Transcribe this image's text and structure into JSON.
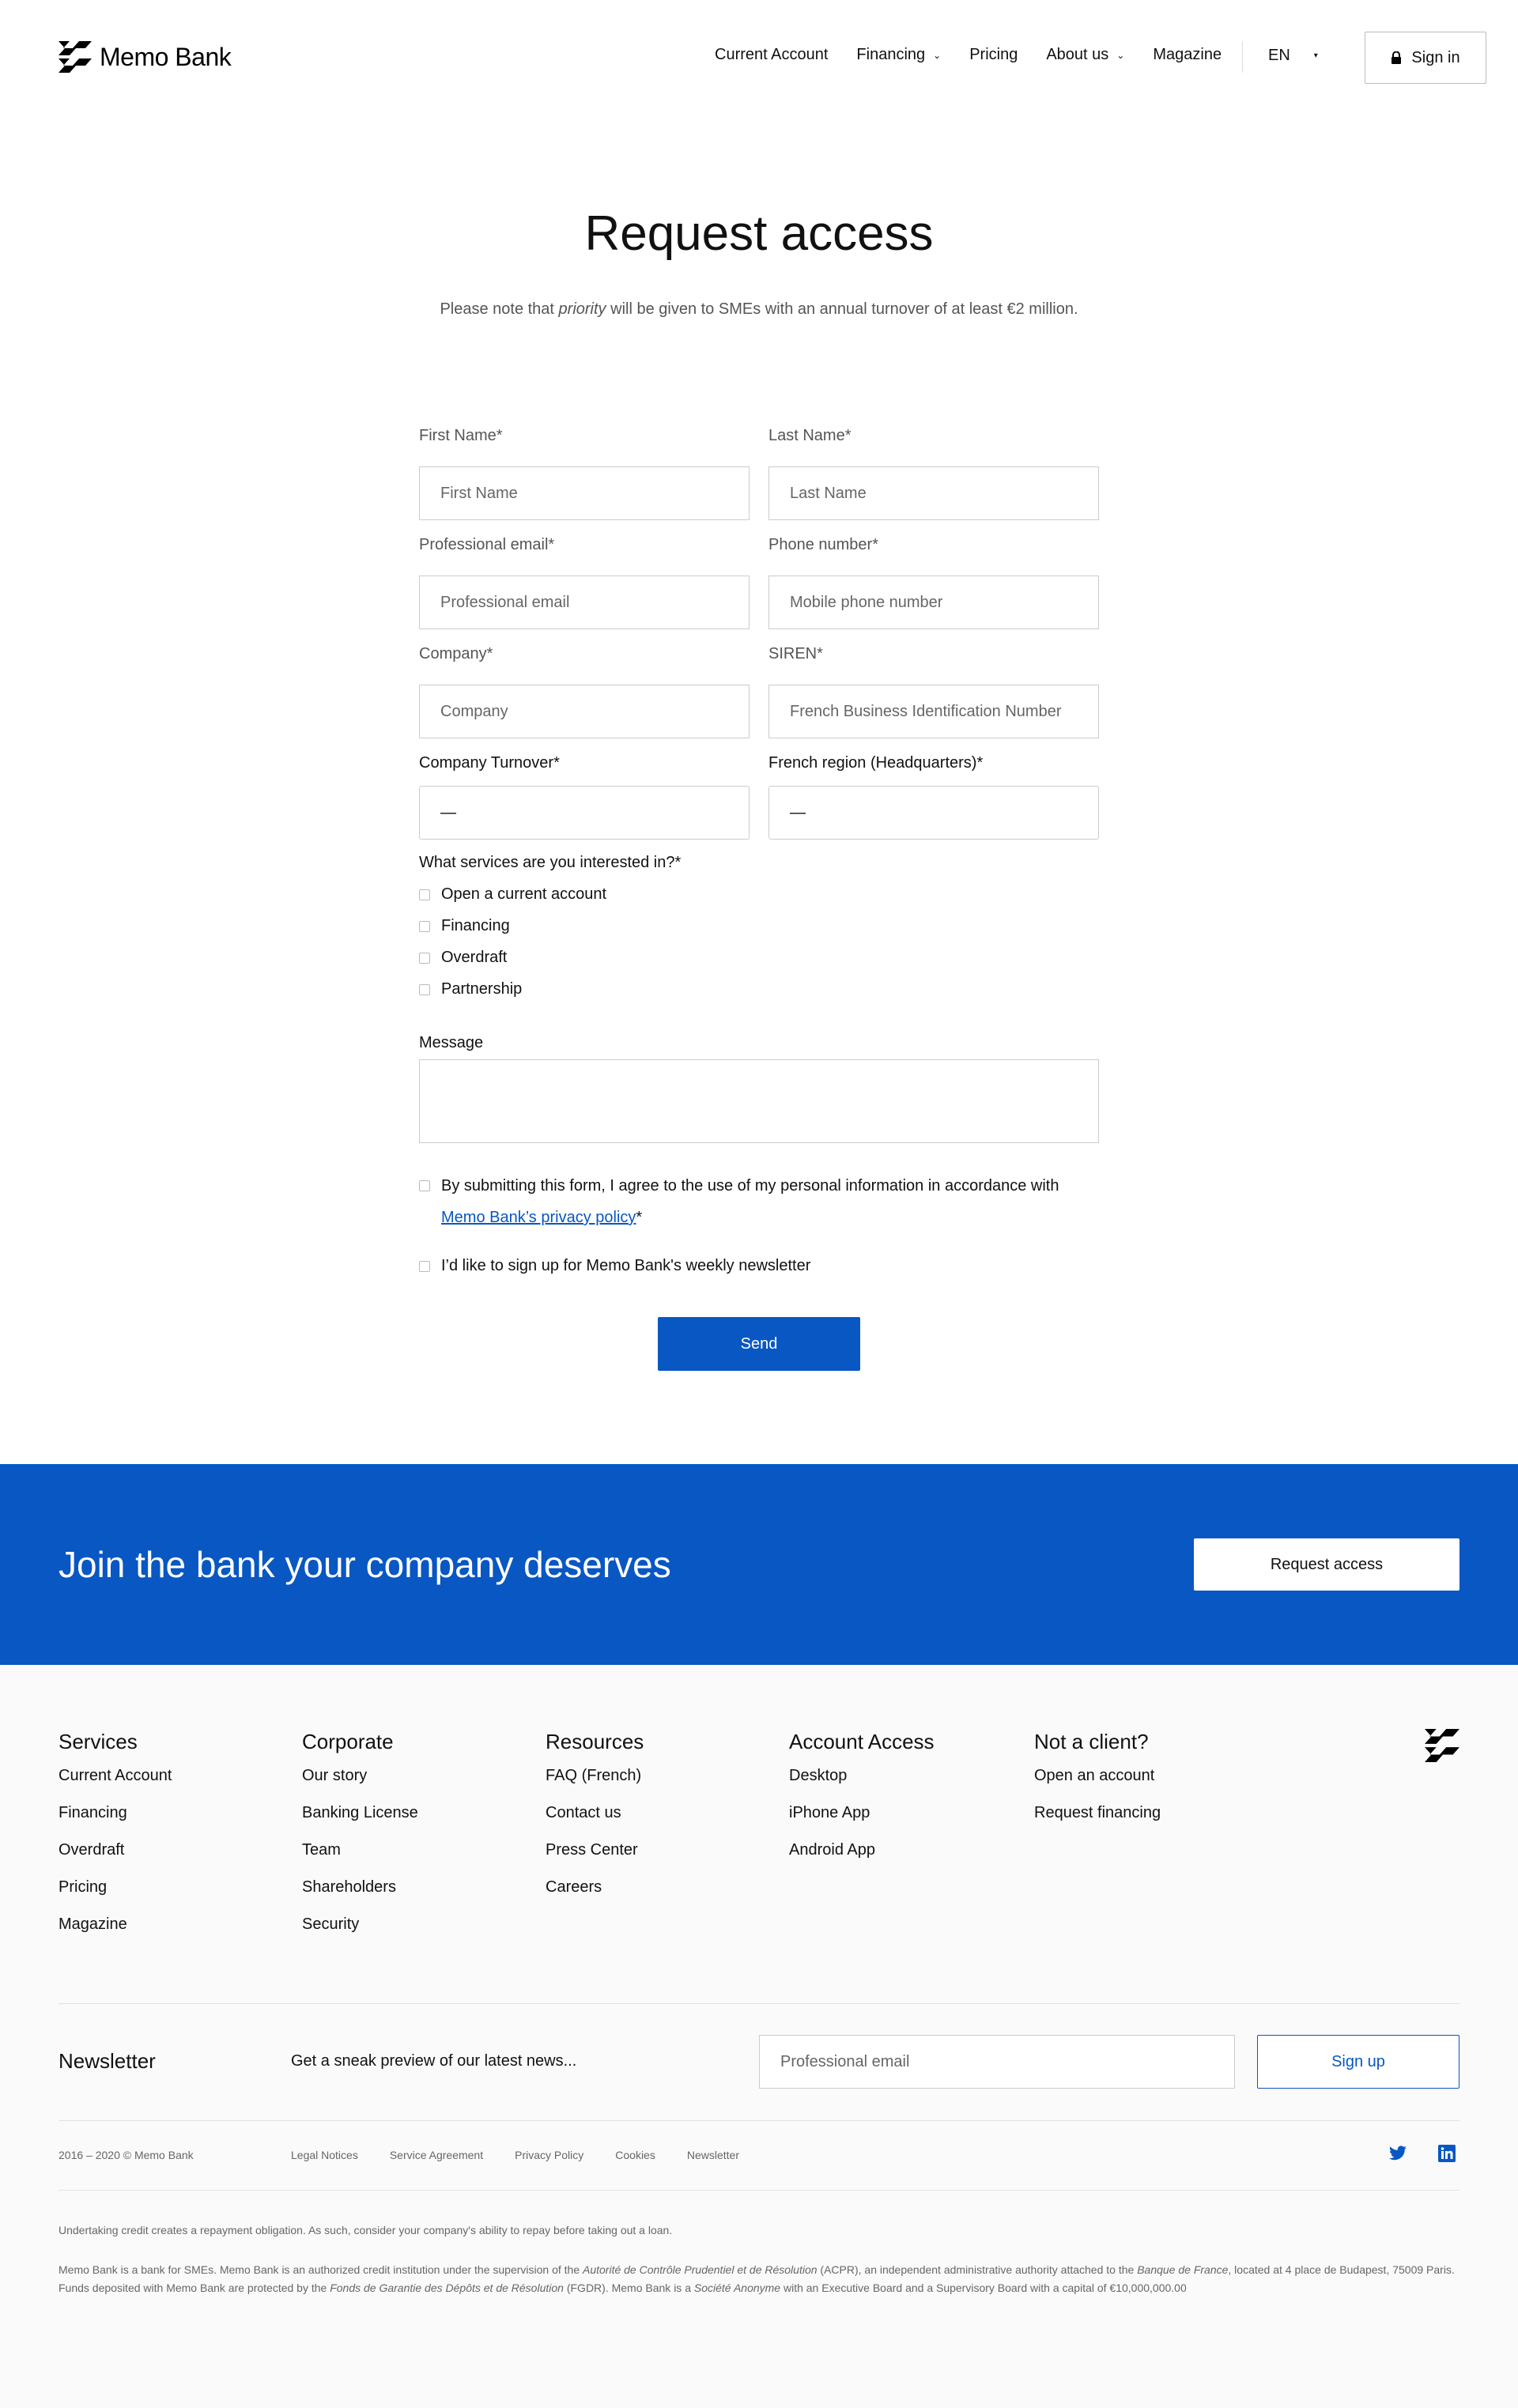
{
  "header": {
    "logo_text": "Memo Bank",
    "nav": [
      {
        "label": "Current Account",
        "dropdown": false
      },
      {
        "label": "Financing",
        "dropdown": true
      },
      {
        "label": "Pricing",
        "dropdown": false
      },
      {
        "label": "About us",
        "dropdown": true
      },
      {
        "label": "Magazine",
        "dropdown": false
      }
    ],
    "language": "EN",
    "signin_label": "Sign in"
  },
  "page": {
    "title": "Request access",
    "subtitle_before": "Please note that ",
    "subtitle_emphasis": "priority",
    "subtitle_after": " will be given to SMEs with an annual turnover of at least €2 million."
  },
  "form": {
    "first_name": {
      "label": "First Name*",
      "placeholder": "First Name"
    },
    "last_name": {
      "label": "Last Name*",
      "placeholder": "Last Name"
    },
    "email": {
      "label": "Professional email*",
      "placeholder": "Professional email"
    },
    "phone": {
      "label": "Phone number*",
      "placeholder": "Mobile phone number"
    },
    "company": {
      "label": "Company*",
      "placeholder": "Company"
    },
    "siren": {
      "label": "SIREN*",
      "placeholder": "French Business Identification Number"
    },
    "turnover": {
      "label": "Company Turnover*",
      "value": "—"
    },
    "region": {
      "label": "French region (Headquarters)*",
      "value": "—"
    },
    "services_label": "What services are you interested in?*",
    "services": [
      "Open a current account",
      "Financing",
      "Overdraft",
      "Partnership"
    ],
    "message_label": "Message",
    "consent_text": "By submitting this form, I agree to the use of my personal information in accordance with ",
    "consent_link": "Memo Bank’s privacy policy",
    "consent_suffix": "*",
    "newsletter_label": "I’d like to sign up for Memo Bank's weekly newsletter",
    "send_label": "Send"
  },
  "banner": {
    "title": "Join the bank your company deserves",
    "button": "Request access"
  },
  "footer": {
    "columns": [
      {
        "title": "Services",
        "items": [
          "Current Account",
          "Financing",
          "Overdraft",
          "Pricing",
          "Magazine"
        ]
      },
      {
        "title": "Corporate",
        "items": [
          "Our story",
          "Banking License",
          "Team",
          "Shareholders",
          "Security"
        ]
      },
      {
        "title": "Resources",
        "items": [
          "FAQ (French)",
          "Contact us",
          "Press Center",
          "Careers"
        ]
      },
      {
        "title": "Account Access",
        "items": [
          "Desktop",
          "iPhone App",
          "Android App"
        ]
      },
      {
        "title": "Not a client?",
        "items": [
          "Open an account",
          "Request financing"
        ]
      }
    ],
    "newsletter": {
      "title": "Newsletter",
      "text": "Get a sneak preview of our latest news...",
      "placeholder": "Professional email",
      "button": "Sign up"
    },
    "copyright": "2016 – 2020 © Memo Bank",
    "legal_links": [
      "Legal Notices",
      "Service Agreement",
      "Privacy Policy",
      "Cookies",
      "Newsletter"
    ],
    "disclaimer1": "Undertaking credit creates a repayment obligation. As such, consider your company's ability to repay before taking out a loan.",
    "disclaimer2": {
      "t1": "Memo Bank is a bank for SMEs. Memo Bank is an authorized credit institution under the supervision of the ",
      "e1": "Autorité de Contrôle Prudentiel et de Résolution",
      "t2": " (ACPR), an independent administrative authority attached to the ",
      "e2": "Banque de France",
      "t3": ", located at 4 place de Budapest, 75009 Paris. Funds deposited with Memo Bank are protected by the ",
      "e3": "Fonds de Garantie des Dépôts et de Résolution",
      "t4": " (FGDR). Memo Bank is a ",
      "e4": "Société Anonyme",
      "t5": " with an Executive Board and a Supervisory Board with a capital of €10,000,000.00"
    }
  },
  "colors": {
    "brand_blue": "#0857c3"
  }
}
